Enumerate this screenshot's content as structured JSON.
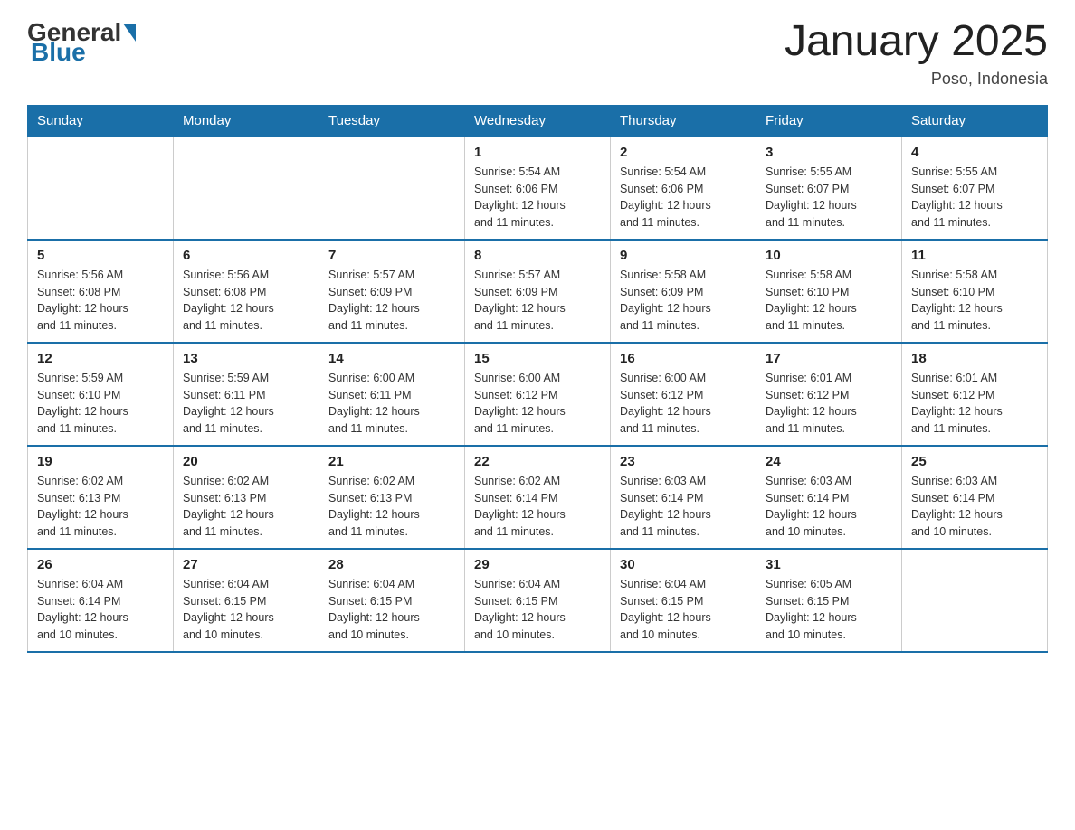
{
  "header": {
    "logo_general": "General",
    "logo_blue": "Blue",
    "title": "January 2025",
    "location": "Poso, Indonesia"
  },
  "days_of_week": [
    "Sunday",
    "Monday",
    "Tuesday",
    "Wednesday",
    "Thursday",
    "Friday",
    "Saturday"
  ],
  "weeks": [
    [
      {
        "day": "",
        "info": ""
      },
      {
        "day": "",
        "info": ""
      },
      {
        "day": "",
        "info": ""
      },
      {
        "day": "1",
        "info": "Sunrise: 5:54 AM\nSunset: 6:06 PM\nDaylight: 12 hours\nand 11 minutes."
      },
      {
        "day": "2",
        "info": "Sunrise: 5:54 AM\nSunset: 6:06 PM\nDaylight: 12 hours\nand 11 minutes."
      },
      {
        "day": "3",
        "info": "Sunrise: 5:55 AM\nSunset: 6:07 PM\nDaylight: 12 hours\nand 11 minutes."
      },
      {
        "day": "4",
        "info": "Sunrise: 5:55 AM\nSunset: 6:07 PM\nDaylight: 12 hours\nand 11 minutes."
      }
    ],
    [
      {
        "day": "5",
        "info": "Sunrise: 5:56 AM\nSunset: 6:08 PM\nDaylight: 12 hours\nand 11 minutes."
      },
      {
        "day": "6",
        "info": "Sunrise: 5:56 AM\nSunset: 6:08 PM\nDaylight: 12 hours\nand 11 minutes."
      },
      {
        "day": "7",
        "info": "Sunrise: 5:57 AM\nSunset: 6:09 PM\nDaylight: 12 hours\nand 11 minutes."
      },
      {
        "day": "8",
        "info": "Sunrise: 5:57 AM\nSunset: 6:09 PM\nDaylight: 12 hours\nand 11 minutes."
      },
      {
        "day": "9",
        "info": "Sunrise: 5:58 AM\nSunset: 6:09 PM\nDaylight: 12 hours\nand 11 minutes."
      },
      {
        "day": "10",
        "info": "Sunrise: 5:58 AM\nSunset: 6:10 PM\nDaylight: 12 hours\nand 11 minutes."
      },
      {
        "day": "11",
        "info": "Sunrise: 5:58 AM\nSunset: 6:10 PM\nDaylight: 12 hours\nand 11 minutes."
      }
    ],
    [
      {
        "day": "12",
        "info": "Sunrise: 5:59 AM\nSunset: 6:10 PM\nDaylight: 12 hours\nand 11 minutes."
      },
      {
        "day": "13",
        "info": "Sunrise: 5:59 AM\nSunset: 6:11 PM\nDaylight: 12 hours\nand 11 minutes."
      },
      {
        "day": "14",
        "info": "Sunrise: 6:00 AM\nSunset: 6:11 PM\nDaylight: 12 hours\nand 11 minutes."
      },
      {
        "day": "15",
        "info": "Sunrise: 6:00 AM\nSunset: 6:12 PM\nDaylight: 12 hours\nand 11 minutes."
      },
      {
        "day": "16",
        "info": "Sunrise: 6:00 AM\nSunset: 6:12 PM\nDaylight: 12 hours\nand 11 minutes."
      },
      {
        "day": "17",
        "info": "Sunrise: 6:01 AM\nSunset: 6:12 PM\nDaylight: 12 hours\nand 11 minutes."
      },
      {
        "day": "18",
        "info": "Sunrise: 6:01 AM\nSunset: 6:12 PM\nDaylight: 12 hours\nand 11 minutes."
      }
    ],
    [
      {
        "day": "19",
        "info": "Sunrise: 6:02 AM\nSunset: 6:13 PM\nDaylight: 12 hours\nand 11 minutes."
      },
      {
        "day": "20",
        "info": "Sunrise: 6:02 AM\nSunset: 6:13 PM\nDaylight: 12 hours\nand 11 minutes."
      },
      {
        "day": "21",
        "info": "Sunrise: 6:02 AM\nSunset: 6:13 PM\nDaylight: 12 hours\nand 11 minutes."
      },
      {
        "day": "22",
        "info": "Sunrise: 6:02 AM\nSunset: 6:14 PM\nDaylight: 12 hours\nand 11 minutes."
      },
      {
        "day": "23",
        "info": "Sunrise: 6:03 AM\nSunset: 6:14 PM\nDaylight: 12 hours\nand 11 minutes."
      },
      {
        "day": "24",
        "info": "Sunrise: 6:03 AM\nSunset: 6:14 PM\nDaylight: 12 hours\nand 10 minutes."
      },
      {
        "day": "25",
        "info": "Sunrise: 6:03 AM\nSunset: 6:14 PM\nDaylight: 12 hours\nand 10 minutes."
      }
    ],
    [
      {
        "day": "26",
        "info": "Sunrise: 6:04 AM\nSunset: 6:14 PM\nDaylight: 12 hours\nand 10 minutes."
      },
      {
        "day": "27",
        "info": "Sunrise: 6:04 AM\nSunset: 6:15 PM\nDaylight: 12 hours\nand 10 minutes."
      },
      {
        "day": "28",
        "info": "Sunrise: 6:04 AM\nSunset: 6:15 PM\nDaylight: 12 hours\nand 10 minutes."
      },
      {
        "day": "29",
        "info": "Sunrise: 6:04 AM\nSunset: 6:15 PM\nDaylight: 12 hours\nand 10 minutes."
      },
      {
        "day": "30",
        "info": "Sunrise: 6:04 AM\nSunset: 6:15 PM\nDaylight: 12 hours\nand 10 minutes."
      },
      {
        "day": "31",
        "info": "Sunrise: 6:05 AM\nSunset: 6:15 PM\nDaylight: 12 hours\nand 10 minutes."
      },
      {
        "day": "",
        "info": ""
      }
    ]
  ]
}
